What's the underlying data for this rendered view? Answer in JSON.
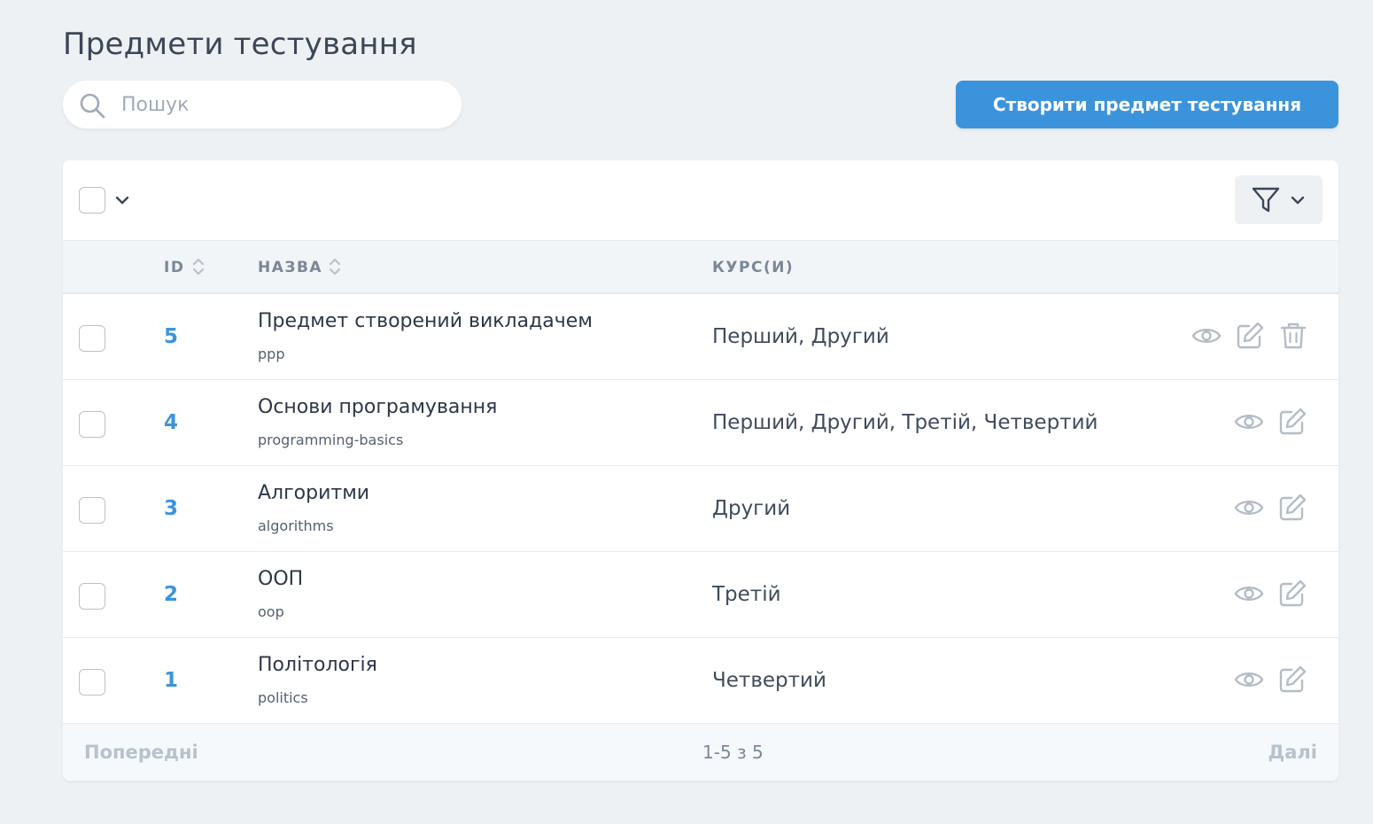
{
  "header": {
    "title": "Предмети тестування",
    "create_label": "Створити предмет тестування"
  },
  "search": {
    "placeholder": "Пошук",
    "value": ""
  },
  "toolbar": {
    "select_icon": "chevron-down-icon",
    "filter_icon": "funnel-icon"
  },
  "table": {
    "columns": [
      "ID",
      "НАЗВА",
      "КУРС(И)"
    ],
    "rows": [
      {
        "id": "5",
        "name": "Предмет створений викладачем",
        "slug": "ppp",
        "courses": "Перший, Другий",
        "actions": [
          "eye-icon",
          "edit-icon",
          "trash-icon"
        ]
      },
      {
        "id": "4",
        "name": "Основи програмування",
        "slug": "programming-basics",
        "courses": "Перший, Другий, Третій, Четвертий",
        "actions": [
          "eye-icon",
          "edit-icon"
        ]
      },
      {
        "id": "3",
        "name": "Алгоритми",
        "slug": "algorithms",
        "courses": "Другий",
        "actions": [
          "eye-icon",
          "edit-icon"
        ]
      },
      {
        "id": "2",
        "name": "ООП",
        "slug": "oop",
        "courses": "Третій",
        "actions": [
          "eye-icon",
          "edit-icon"
        ]
      },
      {
        "id": "1",
        "name": "Політологія",
        "slug": "politics",
        "courses": "Четвертий",
        "actions": [
          "eye-icon",
          "edit-icon"
        ]
      }
    ]
  },
  "pagination": {
    "prev_label": "Попередні",
    "info": "1-5 з 5",
    "next_label": "Далі"
  },
  "colors": {
    "accent": "#3b94db",
    "background": "#eef1f4",
    "icon_gray": "#b4bcc6"
  }
}
